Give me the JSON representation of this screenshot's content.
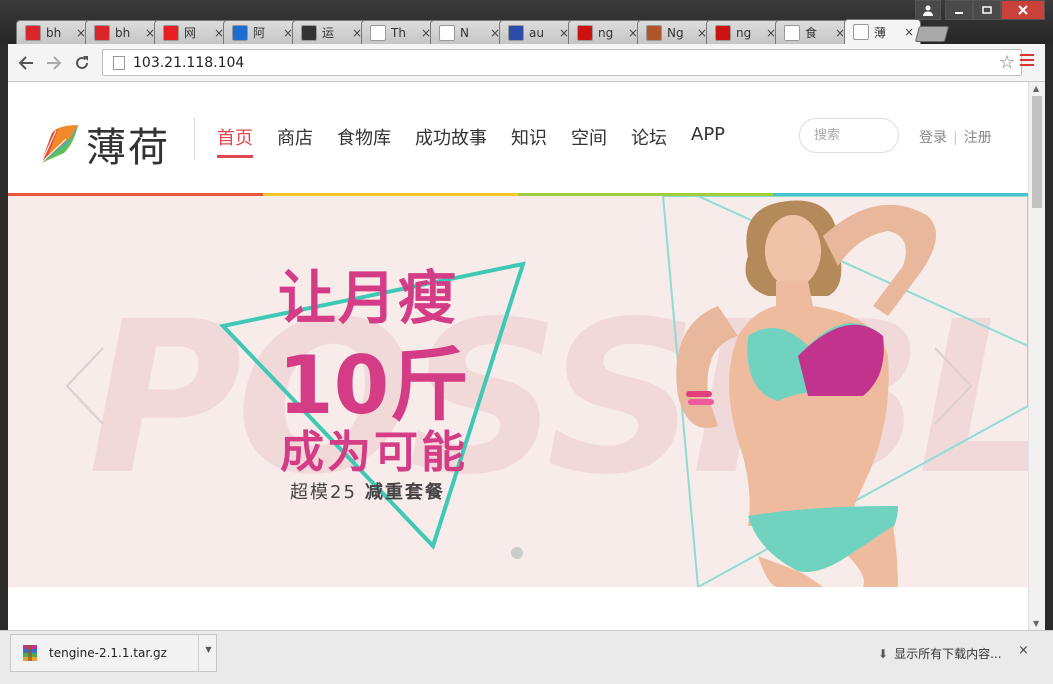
{
  "browser": {
    "tabs": [
      {
        "label": "bh",
        "favicon_color": "#d8262a"
      },
      {
        "label": "bh",
        "favicon_color": "#d8262a"
      },
      {
        "label": "网",
        "favicon_color": "#e81e24"
      },
      {
        "label": "阿",
        "favicon_color": "#1e6cd0"
      },
      {
        "label": "运",
        "favicon_color": "#333333"
      },
      {
        "label": "Th",
        "favicon_color": "#ffffff"
      },
      {
        "label": "N",
        "favicon_color": "#ffffff"
      },
      {
        "label": "au",
        "favicon_color": "#2d4ba8"
      },
      {
        "label": "ng",
        "favicon_color": "#cc1111"
      },
      {
        "label": "Ng",
        "favicon_color": "#b0562a"
      },
      {
        "label": "ng",
        "favicon_color": "#cc1111"
      },
      {
        "label": "食",
        "favicon_color": "#ffffff"
      },
      {
        "label": "薄",
        "favicon_color": "#ffffff",
        "active": true
      }
    ],
    "close_glyph": "×",
    "url": "103.21.118.104",
    "star_glyph": "☆"
  },
  "site": {
    "logo_text": "薄荷",
    "nav": [
      {
        "label": "首页",
        "active": true
      },
      {
        "label": "商店"
      },
      {
        "label": "食物库"
      },
      {
        "label": "成功故事"
      },
      {
        "label": "知识"
      },
      {
        "label": "空间"
      },
      {
        "label": "论坛"
      },
      {
        "label": "APP"
      }
    ],
    "search_placeholder": "搜索",
    "login": "登录",
    "register": "注册",
    "rainbow_colors": [
      "#e9553a",
      "#f4c52b",
      "#9fce3c",
      "#47c2cf"
    ]
  },
  "banner": {
    "headline_line1": "让月瘦",
    "headline_line2": "10斤",
    "headline_line3": "成为可能",
    "sub_prefix": "超模25",
    "sub_bold": "减重套餐",
    "headline_color": "#d43c86",
    "accent_teal": "#3fc8b4"
  },
  "downloads": {
    "file_name": "tengine-2.1.1.tar.gz",
    "show_all": "显示所有下载内容...",
    "close_glyph": "×"
  }
}
